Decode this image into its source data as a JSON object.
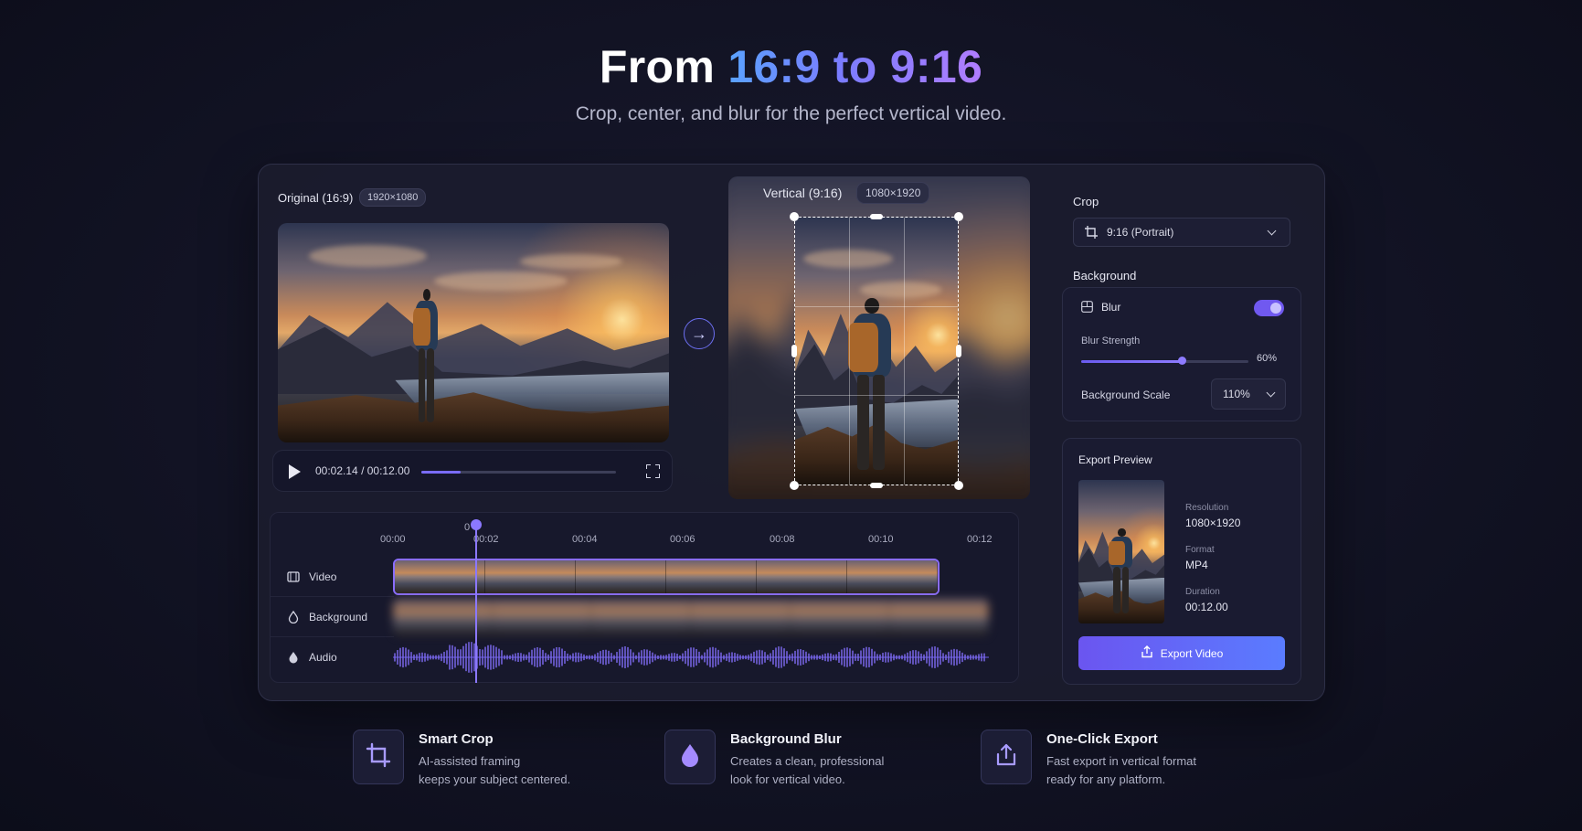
{
  "hero": {
    "title_prefix": "From ",
    "title_highlight": "16:9 to 9:16",
    "subtitle": "Crop, center, and blur for the perfect vertical video."
  },
  "original": {
    "label": "Original (16:9)",
    "badge": "1920×1080"
  },
  "player": {
    "current_time": "00:02.14",
    "separator": "/",
    "total_time": "00:12.00",
    "progress_fraction": 0.2
  },
  "vertical": {
    "label": "Vertical (9:16)",
    "badge": "1080×1920"
  },
  "timeline": {
    "ticks": [
      "00:00",
      "00:02",
      "00:04",
      "00:06",
      "00:08",
      "00:10",
      "00:12"
    ],
    "playhead_label": "0",
    "tracks": [
      "Video",
      "Background",
      "Audio"
    ]
  },
  "settings": {
    "crop_label": "Crop",
    "crop_value": "9:16 (Portrait)",
    "background_label": "Background",
    "blur_label": "Blur",
    "blur_enabled": true,
    "blur_strength_label": "Blur Strength",
    "blur_strength_value": "60%",
    "blur_strength_fraction": 0.6,
    "background_scale_label": "Background Scale",
    "background_scale_value": "110%"
  },
  "export_preview": {
    "title": "Export Preview",
    "resolution_label": "Resolution",
    "resolution_value": "1080×1920",
    "format_label": "Format",
    "format_value": "MP4",
    "duration_label": "Duration",
    "duration_value": "00:12.00",
    "button_label": "Export Video"
  },
  "features": [
    {
      "title": "Smart Crop",
      "line1": "AI-assisted framing",
      "line2": "keeps your subject centered.",
      "icon": "crop-icon"
    },
    {
      "title": "Background Blur",
      "line1": "Creates a clean, professional",
      "line2": "look for vertical video.",
      "icon": "droplet-icon"
    },
    {
      "title": "One-Click Export",
      "line1": "Fast export in vertical format",
      "line2": "ready for any platform.",
      "icon": "share-icon"
    }
  ],
  "colors": {
    "accent": "#7b6cff",
    "accent_blue": "#5a7cff",
    "background": "#121324"
  }
}
